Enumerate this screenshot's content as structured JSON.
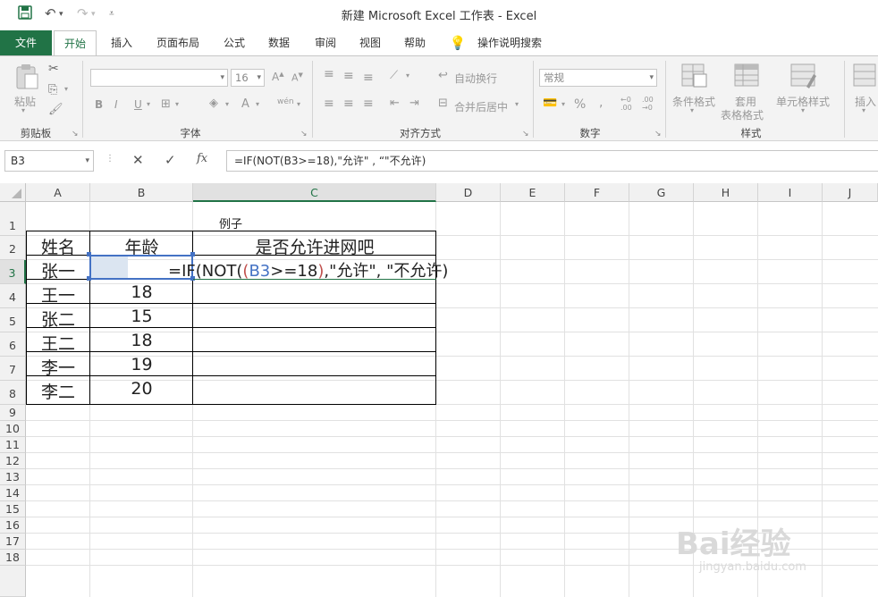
{
  "window": {
    "title": "新建 Microsoft Excel 工作表  -  Excel"
  },
  "quick_access": {
    "save_icon": "save-icon",
    "undo_icon": "undo-icon",
    "redo_icon": "redo-icon",
    "customize_icon": "customize-icon"
  },
  "tabs": [
    "文件",
    "开始",
    "插入",
    "页面布局",
    "公式",
    "数据",
    "审阅",
    "视图",
    "帮助",
    "操作说明搜索"
  ],
  "ribbon": {
    "clipboard": {
      "paste": "粘贴",
      "label": "剪贴板"
    },
    "font": {
      "size": "16",
      "bold": "B",
      "italic": "I",
      "underline": "U",
      "phonetic": "wén",
      "label": "字体"
    },
    "alignment": {
      "wrap": "自动换行",
      "merge": "合并后居中",
      "label": "对齐方式"
    },
    "number": {
      "format": "常规",
      "percent": "%",
      "comma": ",",
      "label": "数字"
    },
    "styles": {
      "conditional": "条件格式",
      "table": "套用",
      "table2": "表格格式",
      "cell": "单元格样式",
      "label": "样式"
    },
    "cells": {
      "insert": "插入"
    }
  },
  "formula_bar": {
    "name_box": "B3",
    "fx": "fx",
    "formula": "=IF(NOT(B3>=18),\"允许\" , “\"不允许)"
  },
  "columns": [
    "A",
    "B",
    "C",
    "D",
    "E",
    "F",
    "G",
    "H",
    "I",
    "J"
  ],
  "rows": [
    "1",
    "2",
    "3",
    "4",
    "5",
    "6",
    "7",
    "8",
    "9",
    "10",
    "11",
    "12",
    "13",
    "14",
    "15",
    "16",
    "17",
    "18"
  ],
  "cells": {
    "C1": "例子",
    "A2": "姓名",
    "B2": "年龄",
    "C2": "是否允许进网吧",
    "A3": "张一",
    "A4": "王一",
    "B4": "18",
    "A5": "张二",
    "B5": "15",
    "A6": "王二",
    "B6": "18",
    "A7": "李一",
    "B7": "19",
    "A8": "李二",
    "B8": "20"
  },
  "edit_formula": {
    "p1": "=IF(NOT(",
    "ref": "B3",
    "p2": ">=18",
    "close": ")",
    "p3": ",\"允许\",    \"不允许)"
  },
  "watermark": {
    "main": "Bai经验",
    "url": "jingyan.baidu.com"
  },
  "colors": {
    "accent": "#217346",
    "ref": "#4472c4",
    "paren": "#c0504d"
  }
}
